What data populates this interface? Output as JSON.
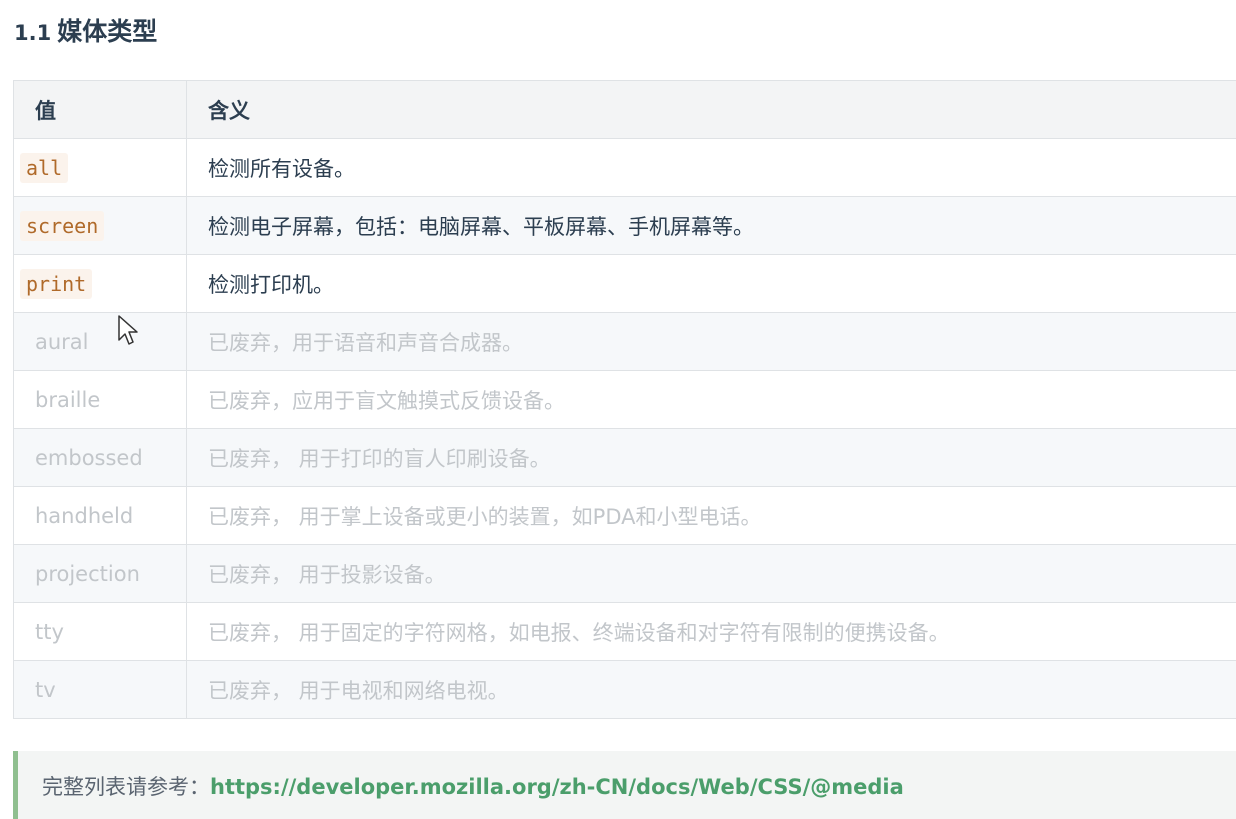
{
  "heading": {
    "number": "1.1",
    "title": "媒体类型"
  },
  "table": {
    "headers": [
      "值",
      "含义"
    ],
    "active_rows": [
      {
        "value": "all",
        "meaning": "检测所有设备。"
      },
      {
        "value": "screen",
        "meaning": "检测电子屏幕，包括：电脑屏幕、平板屏幕、手机屏幕等。"
      },
      {
        "value": "print",
        "meaning": "检测打印机。"
      }
    ],
    "deprecated_rows": [
      {
        "value": "aural",
        "meaning": "已废弃，用于语音和声音合成器。"
      },
      {
        "value": "braille",
        "meaning": "已废弃，应用于盲文触摸式反馈设备。"
      },
      {
        "value": "embossed",
        "meaning": "已废弃， 用于打印的盲人印刷设备。"
      },
      {
        "value": "handheld",
        "meaning": "已废弃， 用于掌上设备或更小的装置，如PDA和小型电话。"
      },
      {
        "value": "projection",
        "meaning": "已废弃， 用于投影设备。"
      },
      {
        "value": "tty",
        "meaning": "已废弃， 用于固定的字符网格，如电报、终端设备和对字符有限制的便携设备。"
      },
      {
        "value": "tv",
        "meaning": "已废弃， 用于电视和网络电视。"
      }
    ]
  },
  "tip": {
    "label": "完整列表请参考：",
    "link_text": "https://developer.mozilla.org/zh-CN/docs/Web/CSS/@media"
  },
  "colors": {
    "code_text": "#b06a2a",
    "code_bg": "#fbf3ec",
    "deprecated_text": "#c2c6ca",
    "link": "#4b9e6b",
    "tip_border": "#8fbf8f"
  },
  "icons": {
    "cursor": "mouse-pointer-icon"
  }
}
